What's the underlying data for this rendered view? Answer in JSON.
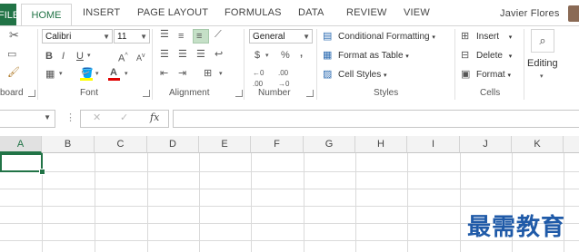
{
  "tabs": {
    "file": "FILE",
    "home": "HOME",
    "insert": "INSERT",
    "page_layout": "PAGE LAYOUT",
    "formulas": "FORMULAS",
    "data": "DATA",
    "review": "REVIEW",
    "view": "VIEW"
  },
  "user": {
    "name": "Javier Flores"
  },
  "ribbon": {
    "clipboard": {
      "label": "board"
    },
    "font": {
      "name": "Calibri",
      "size": "11",
      "label": "Font"
    },
    "alignment": {
      "label": "Alignment"
    },
    "number": {
      "format": "General",
      "label": "Number",
      "currency": "$",
      "percent": "%",
      "comma": ","
    },
    "styles": {
      "conditional": "Conditional Formatting",
      "table": "Format as Table",
      "cell_styles": "Cell Styles",
      "label": "Styles"
    },
    "cells": {
      "insert": "Insert",
      "delete": "Delete",
      "format": "Format",
      "label": "Cells"
    },
    "editing": {
      "label": "Editing"
    }
  },
  "formula_bar": {
    "fx": "fx",
    "cancel": "✕",
    "enter": "✓"
  },
  "columns": [
    "A",
    "B",
    "C",
    "D",
    "E",
    "F",
    "G",
    "H",
    "I",
    "J",
    "K"
  ],
  "watermark": "最需教育",
  "colors": {
    "accent": "#217346",
    "watermark": "#1f5aa8"
  }
}
